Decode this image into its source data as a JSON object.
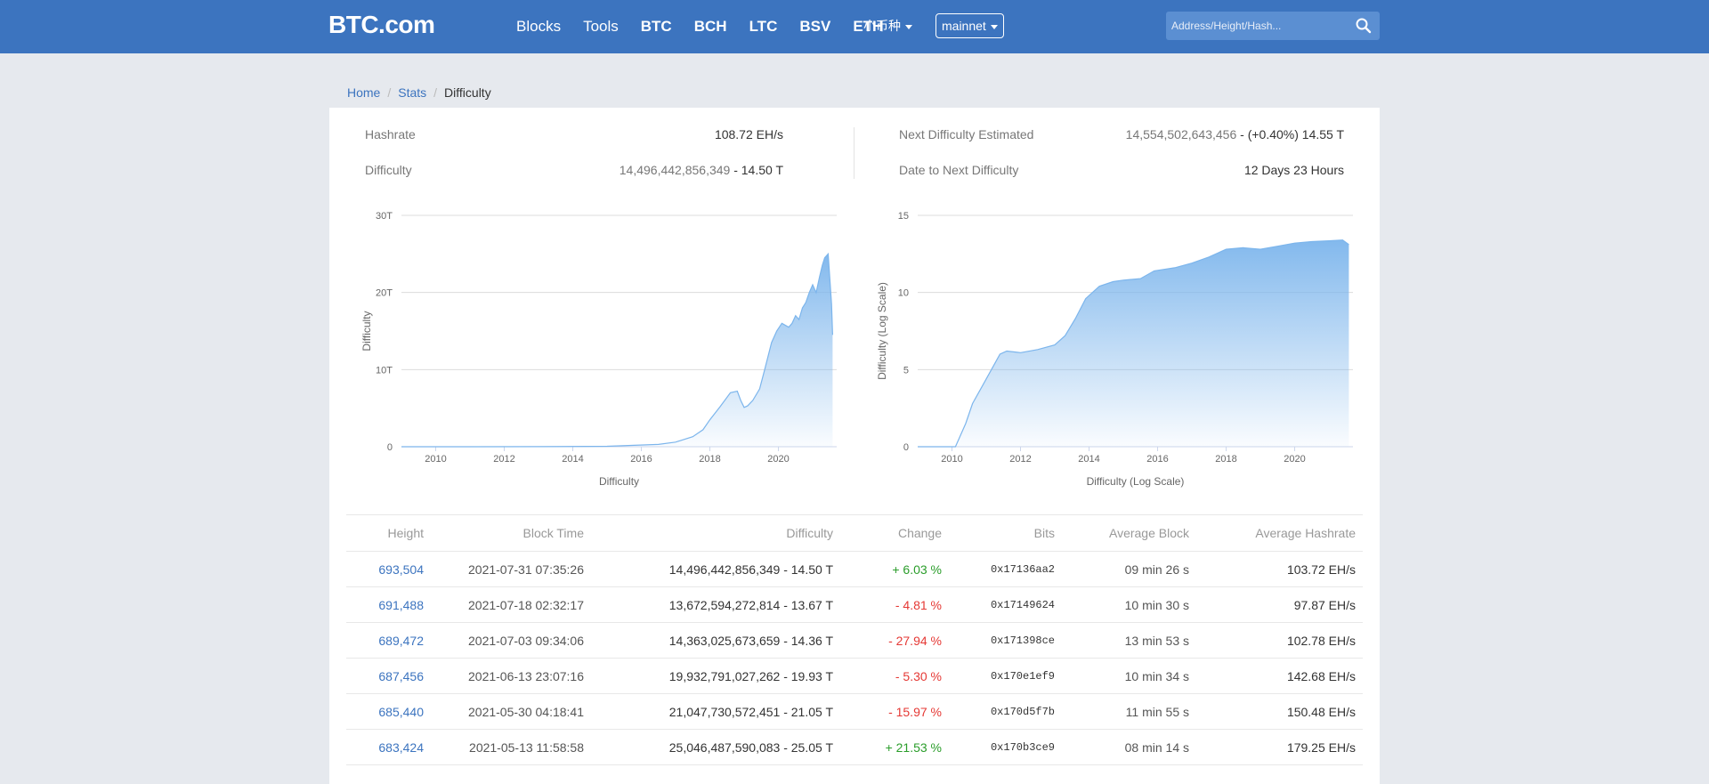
{
  "header": {
    "logo": "BTC.com",
    "nav": [
      {
        "label": "Blocks",
        "bold": false
      },
      {
        "label": "Tools",
        "bold": false
      },
      {
        "label": "BTC",
        "bold": true
      },
      {
        "label": "BCH",
        "bold": true
      },
      {
        "label": "LTC",
        "bold": true
      },
      {
        "label": "BSV",
        "bold": true
      },
      {
        "label": "ETH",
        "bold": true
      }
    ],
    "coin_dropdown": "小币种",
    "network_dropdown": "mainnet",
    "search_placeholder": "Address/Height/Hash..."
  },
  "breadcrumb": {
    "home": "Home",
    "stats": "Stats",
    "current": "Difficulty"
  },
  "stats": {
    "hashrate_label": "Hashrate",
    "hashrate_value": "108.72 EH/s",
    "difficulty_label": "Difficulty",
    "difficulty_raw": "14,496,442,856,349",
    "difficulty_short": " - 14.50 T",
    "next_label": "Next Difficulty Estimated",
    "next_raw": "14,554,502,643,456",
    "next_short": " - (+0.40%) 14.55 T",
    "date_label": "Date to Next Difficulty",
    "date_value": "12 Days 23 Hours"
  },
  "chart_data": [
    {
      "type": "area",
      "title": "",
      "xlabel": "Difficulty",
      "ylabel": "Difficulty",
      "x_ticks": [
        "2010",
        "2012",
        "2014",
        "2016",
        "2018",
        "2020"
      ],
      "y_ticks": [
        "0",
        "10T",
        "20T",
        "30T"
      ],
      "ylim": [
        0,
        30
      ],
      "xlim": [
        2009.0,
        2021.7
      ],
      "color": "#7cb5ec",
      "series": [
        {
          "x": [
            2009.0,
            2011.0,
            2013.0,
            2015.0,
            2016.5,
            2017.0,
            2017.5,
            2017.8,
            2018.0,
            2018.3,
            2018.6,
            2018.8,
            2018.9,
            2019.0,
            2019.1,
            2019.25,
            2019.45,
            2019.6,
            2019.8,
            2019.95,
            2020.1,
            2020.3,
            2020.4,
            2020.5,
            2020.6,
            2020.7,
            2020.8,
            2020.9,
            2021.0,
            2021.1,
            2021.2,
            2021.28,
            2021.35,
            2021.45,
            2021.55,
            2021.58
          ],
          "y": [
            0,
            0,
            0.01,
            0.06,
            0.3,
            0.6,
            1.3,
            2.2,
            3.5,
            5.2,
            7.0,
            7.2,
            6.0,
            5.1,
            5.3,
            6.0,
            7.5,
            10.0,
            13.5,
            15.0,
            16.0,
            15.5,
            16.0,
            17.0,
            16.5,
            18.0,
            18.7,
            20.0,
            21.0,
            20.0,
            22.0,
            23.5,
            24.5,
            25.0,
            18.5,
            14.5
          ]
        }
      ]
    },
    {
      "type": "area",
      "title": "",
      "xlabel": "Difficulty (Log Scale)",
      "ylabel": "Difficulty (Log Scale)",
      "x_ticks": [
        "2010",
        "2012",
        "2014",
        "2016",
        "2018",
        "2020"
      ],
      "y_ticks": [
        "0",
        "5",
        "10",
        "15"
      ],
      "ylim": [
        0,
        15
      ],
      "xlim": [
        2009.0,
        2021.7
      ],
      "color": "#7cb5ec",
      "series": [
        {
          "x": [
            2009.0,
            2010.1,
            2010.4,
            2010.6,
            2010.9,
            2011.2,
            2011.4,
            2011.6,
            2012.0,
            2012.5,
            2013.0,
            2013.3,
            2013.6,
            2013.9,
            2014.3,
            2014.7,
            2015.0,
            2015.5,
            2015.9,
            2016.5,
            2017.0,
            2017.5,
            2018.0,
            2018.5,
            2019.0,
            2019.5,
            2020.0,
            2020.5,
            2021.0,
            2021.4,
            2021.58
          ],
          "y": [
            0,
            0,
            1.5,
            2.8,
            4.0,
            5.2,
            6.0,
            6.2,
            6.1,
            6.3,
            6.6,
            7.2,
            8.3,
            9.6,
            10.4,
            10.7,
            10.8,
            10.9,
            11.4,
            11.6,
            11.9,
            12.3,
            12.8,
            12.9,
            12.8,
            13.0,
            13.2,
            13.3,
            13.35,
            13.4,
            13.1
          ]
        }
      ]
    }
  ],
  "table": {
    "headers": [
      "Height",
      "Block Time",
      "Difficulty",
      "Change",
      "Bits",
      "Average Block",
      "Average Hashrate"
    ],
    "rows": [
      {
        "height": "693,504",
        "time": "2021-07-31 07:35:26",
        "difficulty": "14,496,442,856,349 - 14.50 T",
        "change": "+ 6.03 %",
        "dir": "up",
        "bits": "0x17136aa2",
        "avg_block": "09 min 26 s",
        "avg_hash": "103.72 EH/s"
      },
      {
        "height": "691,488",
        "time": "2021-07-18 02:32:17",
        "difficulty": "13,672,594,272,814 - 13.67 T",
        "change": "- 4.81 %",
        "dir": "down",
        "bits": "0x17149624",
        "avg_block": "10 min 30 s",
        "avg_hash": "97.87 EH/s"
      },
      {
        "height": "689,472",
        "time": "2021-07-03 09:34:06",
        "difficulty": "14,363,025,673,659 - 14.36 T",
        "change": "- 27.94 %",
        "dir": "down",
        "bits": "0x171398ce",
        "avg_block": "13 min 53 s",
        "avg_hash": "102.78 EH/s"
      },
      {
        "height": "687,456",
        "time": "2021-06-13 23:07:16",
        "difficulty": "19,932,791,027,262 - 19.93 T",
        "change": "- 5.30 %",
        "dir": "down",
        "bits": "0x170e1ef9",
        "avg_block": "10 min 34 s",
        "avg_hash": "142.68 EH/s"
      },
      {
        "height": "685,440",
        "time": "2021-05-30 04:18:41",
        "difficulty": "21,047,730,572,451 - 21.05 T",
        "change": "- 15.97 %",
        "dir": "down",
        "bits": "0x170d5f7b",
        "avg_block": "11 min 55 s",
        "avg_hash": "150.48 EH/s"
      },
      {
        "height": "683,424",
        "time": "2021-05-13 11:58:58",
        "difficulty": "25,046,487,590,083 - 25.05 T",
        "change": "+ 21.53 %",
        "dir": "up",
        "bits": "0x170b3ce9",
        "avg_block": "08 min 14 s",
        "avg_hash": "179.25 EH/s"
      }
    ]
  }
}
